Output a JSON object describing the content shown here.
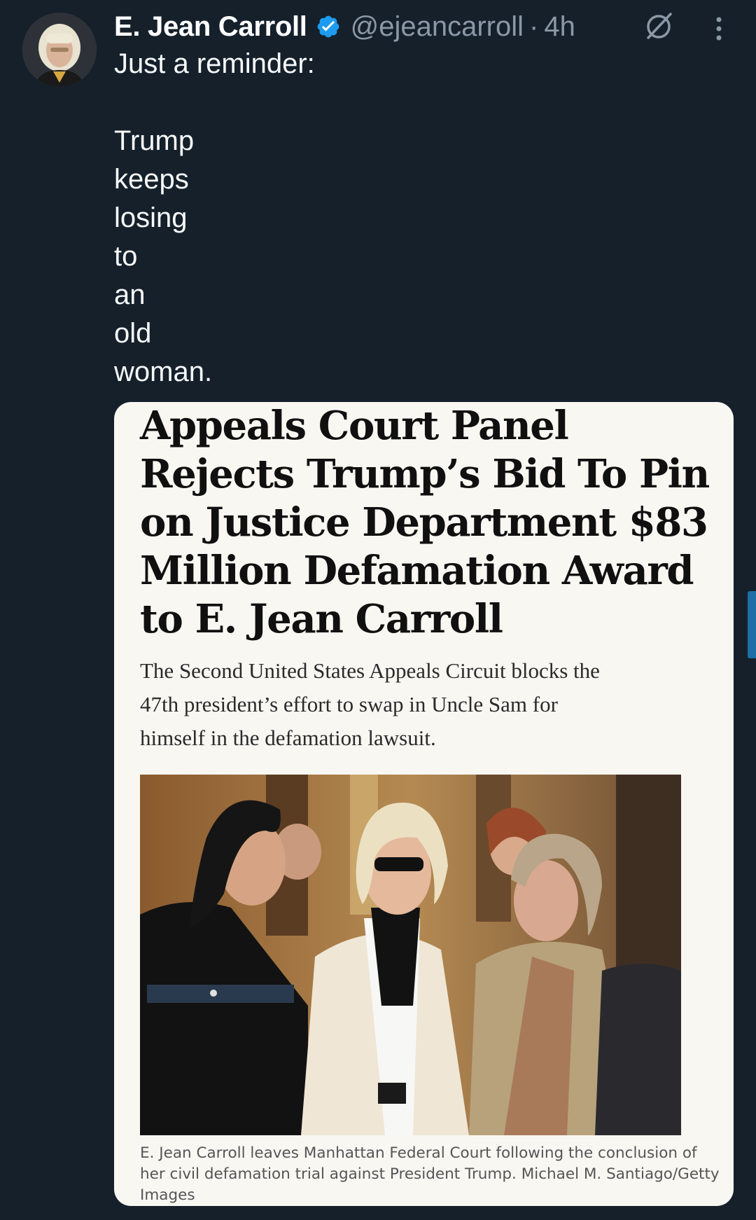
{
  "author": {
    "display_name": "E. Jean Carroll",
    "handle": "@ejeancarroll",
    "separator": "·",
    "time": "4h",
    "verified": true,
    "avatar": "profile-photo"
  },
  "icons": {
    "verified": "verified-badge-icon",
    "grok": "grok-icon",
    "more": "more-options-icon"
  },
  "tweet": {
    "lines": [
      "Just a reminder:",
      "",
      "Trump",
      "keeps",
      "losing",
      "to",
      "an",
      "old",
      "woman."
    ]
  },
  "article": {
    "headline_lines": [
      "Appeals Court Panel",
      "Rejects Trump’s Bid To Pin",
      "on Justice Department $83",
      "Million Defamation Award",
      "to E. Jean Carroll"
    ],
    "dek_lines": [
      "The Second United States Appeals Circuit blocks the",
      "47th president’s effort to swap in Uncle Sam for",
      "himself in the defamation lawsuit."
    ],
    "caption_lines": [
      "E. Jean Carroll leaves Manhattan Federal Court following the conclusion of",
      "her civil defamation trial against President Trump. Michael M. Santiago/Getty",
      "Images"
    ]
  },
  "colors": {
    "background": "#15202b",
    "text": "#f7f9f9",
    "secondary_text": "#8b98a5",
    "verified_blue": "#1d9bf0",
    "card_background": "#f8f7f2"
  }
}
